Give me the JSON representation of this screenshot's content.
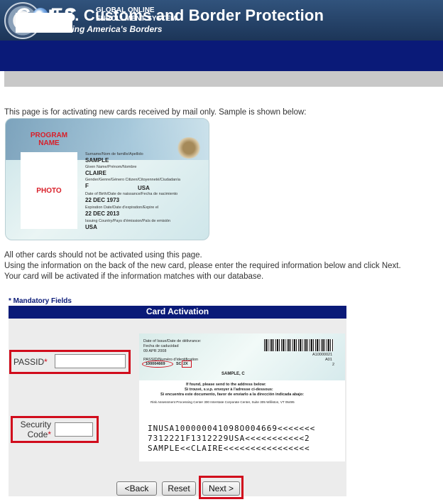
{
  "header": {
    "agency_title": "U.S. Customs and Border Protection",
    "agency_subtitle": "Securing America's Borders",
    "system_logo": "GOES",
    "system_logo_prefix": "G",
    "system_logo_suffix": "ES",
    "system_name_line1": "GLOBAL ONLINE",
    "system_name_line2": "ENROLLMENT SYSTEM"
  },
  "intro": {
    "text": "This page is for activating new cards received by mail only. Sample is shown below:"
  },
  "sample_card_front": {
    "program_label": "PROGRAM NAME",
    "photo_label": "PHOTO",
    "surname_label": "Surname/Nom de famille/Apellido",
    "surname_value": "SAMPLE",
    "given_label": "Given Name/Prénom/Nombre",
    "given_value": "CLAIRE",
    "gender_label": "Gender/Genre/Género  Citizen/Citoyenneté/Ciudadanía",
    "gender_value": "F",
    "citizen_value": "USA",
    "dob_label": "Date of Birth/Date de naissance/Fecha de nacimiento",
    "dob_value": "22 DEC 1973",
    "exp_label": "Expiration Date/Date d'expiration/Expire el",
    "exp_value": "22 DEC 2013",
    "issuing_label": "Issuing Country/Pays d'émission/País de emisión",
    "issuing_value": "USA"
  },
  "notes": {
    "line1": "All other cards should not be activated using this page.",
    "line2": "Using the information on the back of the new card, please enter the required information below and click Next.",
    "line3": "Your card will be activated if the information matches with our database."
  },
  "form": {
    "mandatory_note": "* Mandatory Fields",
    "panel_title": "Card Activation",
    "passid_label": "PASSID",
    "passid_value": "",
    "security_label": "Security Code",
    "security_value": "",
    "required_marker": "*"
  },
  "sample_card_back": {
    "issue_label_en": "Date of Issue/Date de délivrance:",
    "issue_label_es": "Fecha de caducidad",
    "issue_value": "09 APR 2008",
    "passid_label": "PASSID/Numéro d'identification",
    "passid_value": "100004669",
    "sc_label": "SC",
    "sc_value": "2X",
    "right_code": "A10000021",
    "right_class": "A01",
    "right_num": "2",
    "name_value": "SAMPLE, C",
    "found_line1": "If found, please send to the address below:",
    "found_line2": "Si trouvé, s.v.p. envoyer à l'adresse ci-dessous:",
    "found_line3": "Si encuentra este documento, favor de enviarlo a la dirección indicada abajo:",
    "address_line": "Risk Assessment Processing Center  300 Interstate Corporate Center, Suite 305  Williston, VT 05495",
    "mrz_line1": "INUSA100000041098O004669<<<<<<<",
    "mrz_line2": "7312221F1312229USA<<<<<<<<<<<2",
    "mrz_line3": "SAMPLE<<CLAIRE<<<<<<<<<<<<<<<<"
  },
  "buttons": {
    "back_label": "<Back",
    "reset_label": "Reset",
    "next_label": "Next >"
  },
  "colors": {
    "navy": "#0a1a78",
    "highlight_red": "#d10c1c",
    "panel_gray": "#ececec"
  }
}
